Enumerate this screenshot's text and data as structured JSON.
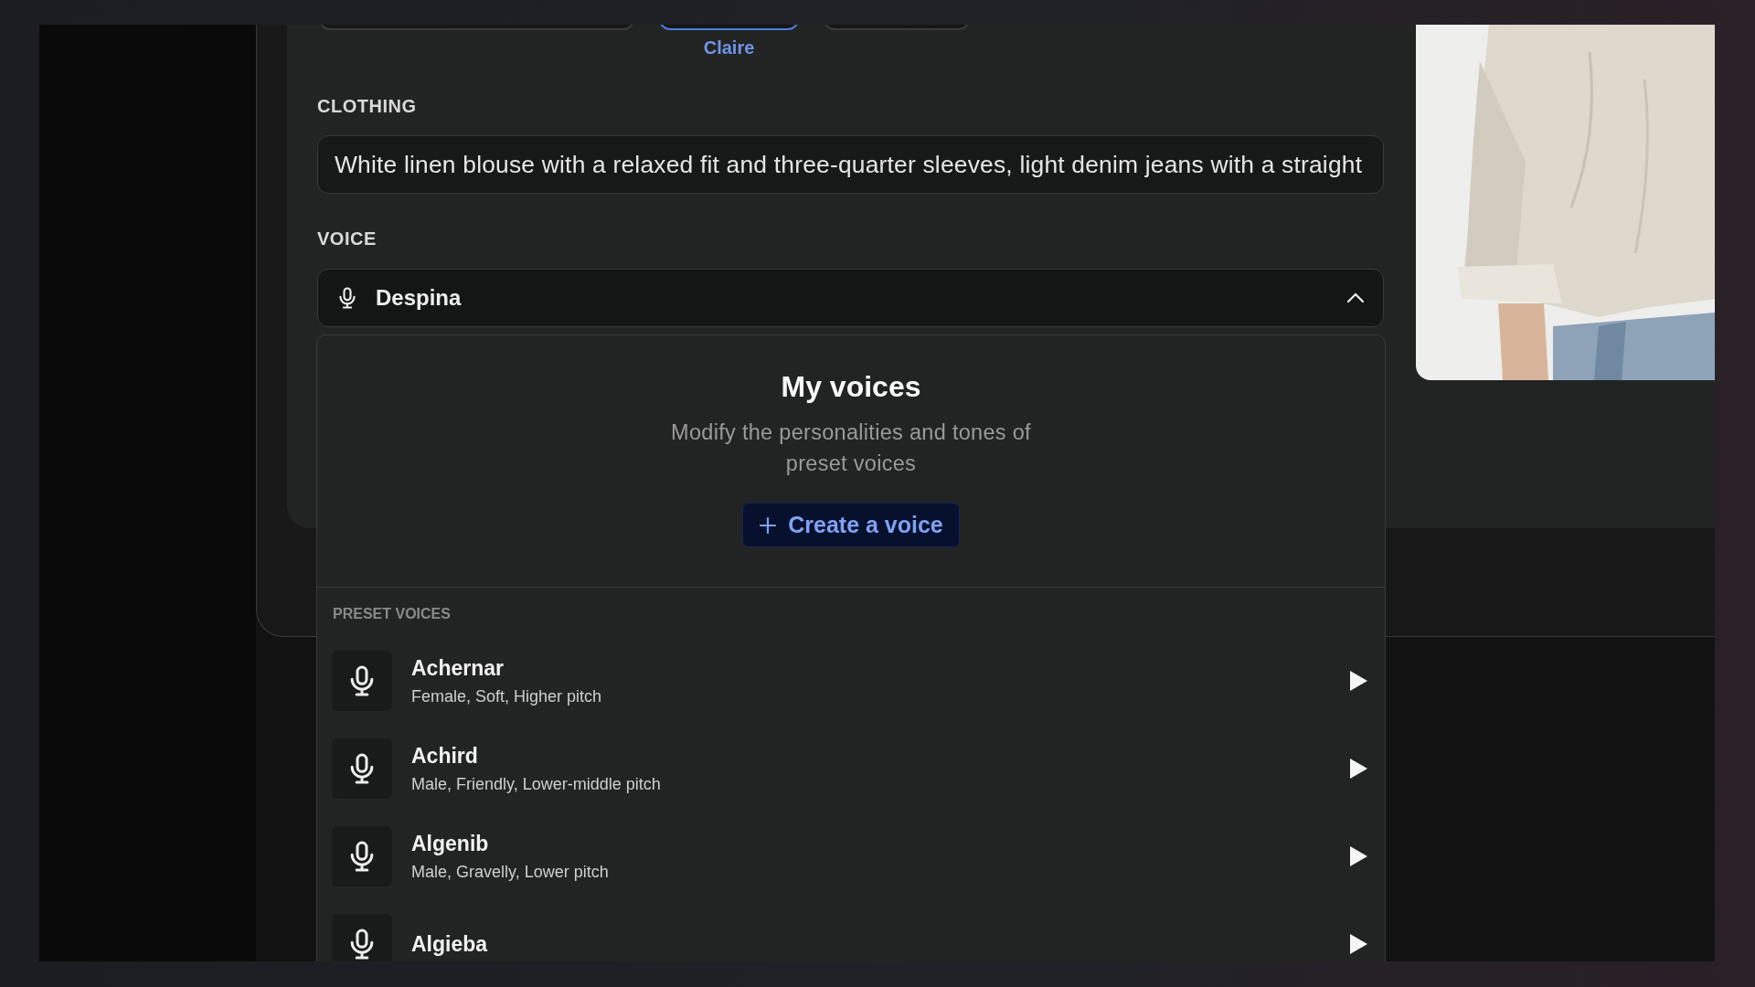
{
  "characters": [
    {
      "selected": false
    },
    {
      "name": "Claire",
      "selected": true
    },
    {
      "selected": false
    }
  ],
  "clothing": {
    "label": "CLOTHING",
    "value": "White linen blouse with a relaxed fit and three-quarter sleeves, light denim jeans with a straight"
  },
  "voice": {
    "label": "VOICE",
    "value": "Despina",
    "expanded": true
  },
  "dropdown": {
    "title": "My voices",
    "subtitle": "Modify the personalities and tones of preset voices",
    "create_button": "Create a voice",
    "section": "PRESET VOICES",
    "voices": [
      {
        "name": "Achernar",
        "description": "Female, Soft, Higher pitch"
      },
      {
        "name": "Achird",
        "description": "Male, Friendly, Lower-middle pitch"
      },
      {
        "name": "Algenib",
        "description": "Male, Gravelly, Lower pitch"
      },
      {
        "name": "Algieba"
      }
    ]
  }
}
